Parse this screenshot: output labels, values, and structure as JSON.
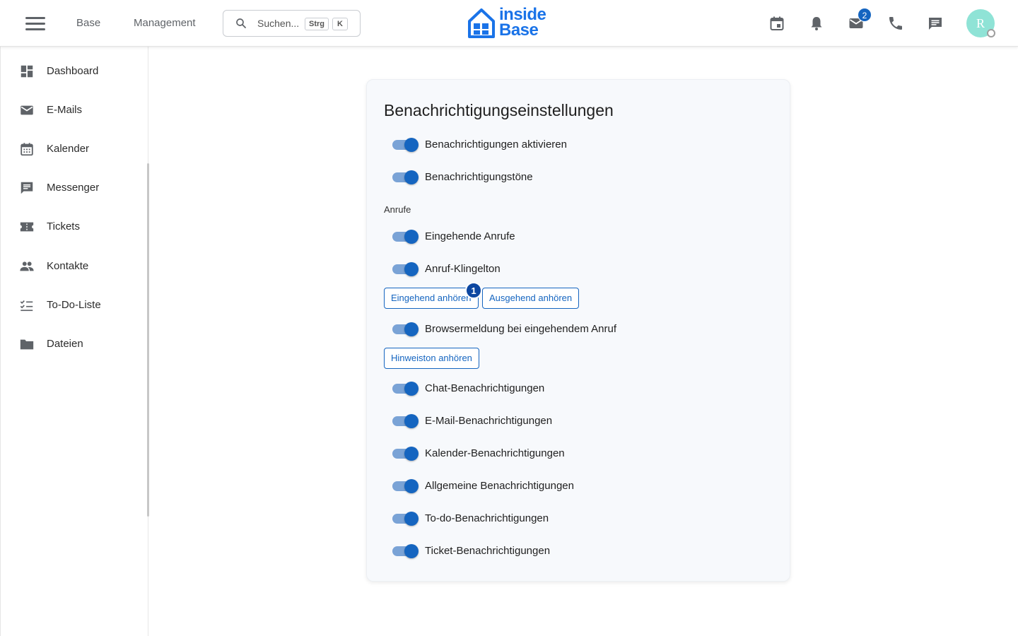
{
  "header": {
    "nav": [
      "Base",
      "Management"
    ],
    "search_placeholder": "Suchen...",
    "shortcut_keys": [
      "Strg",
      "K"
    ],
    "logo_text": [
      "inside",
      "Base"
    ],
    "mail_badge": "2",
    "avatar_initial": "R",
    "icons": [
      "calendar-icon",
      "bell-icon",
      "mail-icon",
      "phone-icon",
      "chat-icon"
    ]
  },
  "sidebar": {
    "items": [
      {
        "label": "Dashboard",
        "icon": "dashboard-icon"
      },
      {
        "label": "E-Mails",
        "icon": "mail-icon"
      },
      {
        "label": "Kalender",
        "icon": "calendar-icon"
      },
      {
        "label": "Messenger",
        "icon": "chat-icon"
      },
      {
        "label": "Tickets",
        "icon": "ticket-icon"
      },
      {
        "label": "Kontakte",
        "icon": "people-icon"
      },
      {
        "label": "To-Do-Liste",
        "icon": "checklist-icon"
      },
      {
        "label": "Dateien",
        "icon": "folder-icon"
      }
    ]
  },
  "settings": {
    "title": "Benachrichtigungseinstellungen",
    "section_calls": "Anrufe",
    "toggles": [
      {
        "label": "Benachrichtigungen aktivieren",
        "on": true
      },
      {
        "label": "Benachrichtigungstöne",
        "on": true
      },
      {
        "label": "Eingehende Anrufe",
        "on": true
      },
      {
        "label": "Anruf-Klingelton",
        "on": true
      },
      {
        "label": "Browsermeldung bei eingehendem Anruf",
        "on": true
      },
      {
        "label": "Chat-Benachrichtigungen",
        "on": true
      },
      {
        "label": "E-Mail-Benachrichtigungen",
        "on": true
      },
      {
        "label": "Kalender-Benachrichtigungen",
        "on": true
      },
      {
        "label": "Allgemeine Benachrichtigungen",
        "on": true
      },
      {
        "label": "To-do-Benachrichtigungen",
        "on": true
      },
      {
        "label": "Ticket-Benachrichtigungen",
        "on": true
      }
    ],
    "buttons": {
      "incoming": "Eingehend anhören",
      "outgoing": "Ausgehend anhören",
      "hint": "Hinweiston anhören"
    },
    "step_badge": "1"
  },
  "colors": {
    "accent": "#1565c0",
    "track": "#7aa3d6",
    "avatar": "#8fe3d6"
  }
}
